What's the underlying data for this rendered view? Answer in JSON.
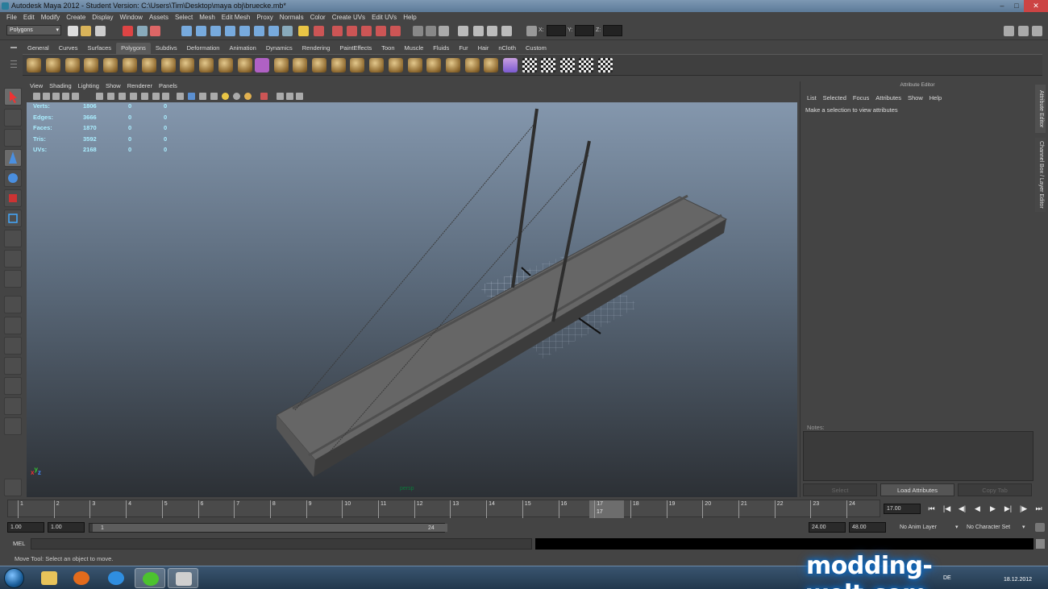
{
  "window": {
    "title": "Autodesk Maya 2012 - Student Version: C:\\Users\\Tim\\Desktop\\maya obj\\bruecke.mb*",
    "minimize_glyph": "–",
    "maximize_glyph": "□",
    "close_glyph": "✕"
  },
  "menubar": [
    "File",
    "Edit",
    "Modify",
    "Create",
    "Display",
    "Window",
    "Assets",
    "Select",
    "Mesh",
    "Edit Mesh",
    "Proxy",
    "Normals",
    "Color",
    "Create UVs",
    "Edit UVs",
    "Help"
  ],
  "status_line": {
    "mode": "Polygons",
    "x_label": "X:",
    "y_label": "Y:",
    "z_label": "Z:"
  },
  "shelf": {
    "tabs": [
      "General",
      "Curves",
      "Surfaces",
      "Polygons",
      "Subdivs",
      "Deformation",
      "Animation",
      "Dynamics",
      "Rendering",
      "PaintEffects",
      "Toon",
      "Muscle",
      "Fluids",
      "Fur",
      "Hair",
      "nCloth",
      "Custom"
    ],
    "active_tab": "Polygons"
  },
  "panel": {
    "menu": [
      "View",
      "Shading",
      "Lighting",
      "Show",
      "Renderer",
      "Panels"
    ],
    "camera": "persp",
    "axis_x": "x",
    "axis_y": "y",
    "axis_z": "z"
  },
  "hud": {
    "rows": [
      {
        "label": "Verts:",
        "v1": "1806",
        "v2": "0",
        "v3": "0"
      },
      {
        "label": "Edges:",
        "v1": "3666",
        "v2": "0",
        "v3": "0"
      },
      {
        "label": "Faces:",
        "v1": "1870",
        "v2": "0",
        "v3": "0"
      },
      {
        "label": "Tris:",
        "v1": "3592",
        "v2": "0",
        "v3": "0"
      },
      {
        "label": "UVs:",
        "v1": "2168",
        "v2": "0",
        "v3": "0"
      }
    ]
  },
  "attribute_editor": {
    "title": "Attribute Editor",
    "menu": [
      "List",
      "Selected",
      "Focus",
      "Attributes",
      "Show",
      "Help"
    ],
    "message": "Make a selection to view attributes",
    "notes_label": "Notes:",
    "buttons": [
      "Select",
      "Load Attributes",
      "Copy Tab"
    ],
    "side_tabs": [
      "Attribute Editor",
      "Channel Box / Layer Editor"
    ]
  },
  "timeline": {
    "ticks": [
      "1",
      "2",
      "3",
      "4",
      "5",
      "6",
      "7",
      "8",
      "9",
      "10",
      "11",
      "12",
      "13",
      "14",
      "15",
      "16",
      "17",
      "18",
      "19",
      "20",
      "21",
      "22",
      "23",
      "24"
    ],
    "current_frame": "17",
    "current_field": "17.00",
    "playback": [
      "⏮",
      "|◀",
      "◀|",
      "◀",
      "▶",
      "▶|",
      "|▶",
      "⏭"
    ]
  },
  "range": {
    "start": "1.00",
    "playback_start": "1.00",
    "range_start_label": "1",
    "range_end_label": "24",
    "playback_end": "24.00",
    "end": "48.00",
    "anim_layer": "No Anim Layer",
    "character_set": "No Character Set"
  },
  "command_line": {
    "label": "MEL"
  },
  "help_line": "Move Tool: Select an object to move.",
  "taskbar": {
    "tray_lang": "DE",
    "tray_date": "18.12.2012"
  },
  "watermark": "modding-welt.com",
  "colors": {
    "ui_bg": "#444444",
    "viewport_top": "#8497ad",
    "viewport_bottom": "#2c3035",
    "hud_text": "#aaeeff",
    "close_red": "#cc4444"
  }
}
